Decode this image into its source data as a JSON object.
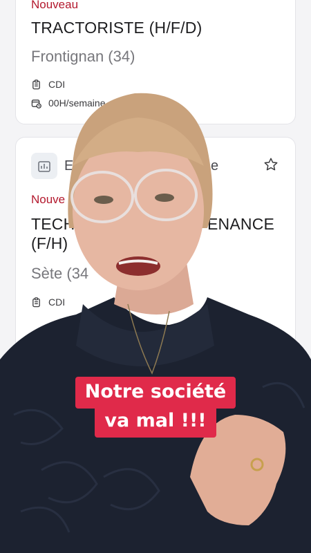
{
  "cards": [
    {
      "badge": "Nouveau",
      "title": "TRACTORISTE (H/F/D)",
      "location": "Frontignan (34)",
      "contract": "CDI",
      "hours": "00H/semaine"
    },
    {
      "company_visible_start": "E",
      "company_visible_end": "e",
      "badge_visible": "Nouve",
      "title_line1_start": "TECH",
      "title_line1_end": "ENANCE",
      "title_line2": "(F/H)",
      "location_visible": "Sète (34",
      "contract": "CDI"
    }
  ],
  "caption": {
    "line1": "Notre société",
    "line2": "va mal !!!"
  },
  "colors": {
    "badge": "#b3182d",
    "caption_bg": "#e02a4a",
    "sweater": "#1c2230",
    "hair": "#c9a27c",
    "skin": "#e6b7a2"
  },
  "icons": [
    "clipboard-icon",
    "calendar-clock-icon",
    "building-icon",
    "star-icon"
  ]
}
